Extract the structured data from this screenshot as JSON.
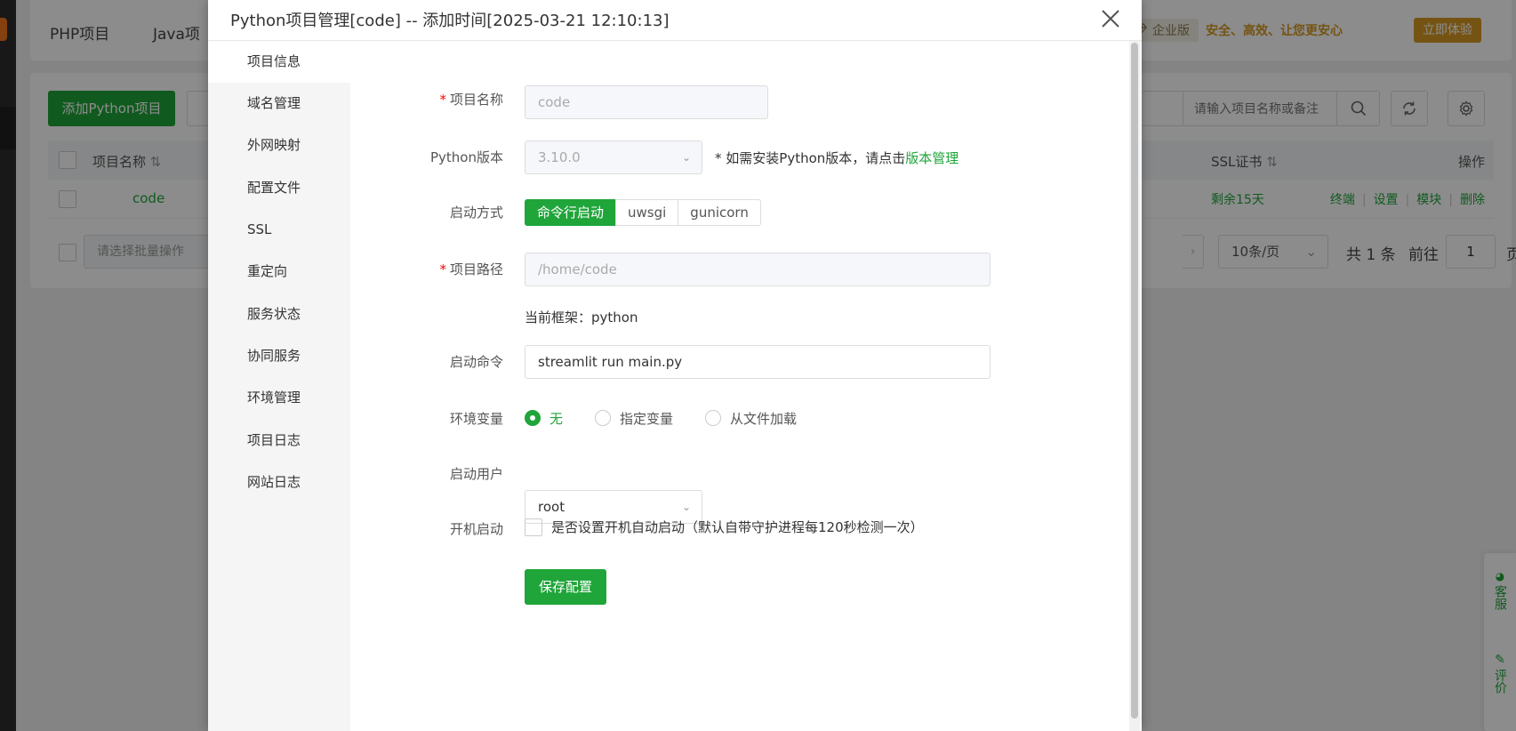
{
  "background": {
    "tabs": [
      "PHP项目",
      "Java项"
    ],
    "enterprise_badge": "企业版",
    "enterprise_slogan": "安全、高效、让您更安心",
    "trial_button": "立即体验",
    "add_button": "添加Python项目",
    "search_placeholder": "请输入项目名称或备注",
    "table": {
      "col_name": "项目名称",
      "col_ssl": "SSL证书",
      "col_ops": "操作",
      "row": {
        "name": "code",
        "ssl": "剩余15天",
        "ops": [
          "终端",
          "设置",
          "模块",
          "删除"
        ]
      }
    },
    "batch_placeholder": "请选择批量操作",
    "page_size": "10条/页",
    "total_text": "共 1 条",
    "goto_text": "前往",
    "page_value": "1",
    "page_unit": "页",
    "float_tools": {
      "service": "客服",
      "review": "评价"
    }
  },
  "modal": {
    "title": "Python项目管理[code] -- 添加时间[2025-03-21 12:10:13]",
    "nav": [
      "项目信息",
      "域名管理",
      "外网映射",
      "配置文件",
      "SSL",
      "重定向",
      "服务状态",
      "协同服务",
      "环境管理",
      "项目日志",
      "网站日志"
    ],
    "form": {
      "name_label": "项目名称",
      "name_value": "code",
      "python_label": "Python版本",
      "python_value": "3.10.0",
      "python_hint": "* 如需安装Python版本，请点击",
      "python_hint_link": "版本管理",
      "start_mode_label": "启动方式",
      "start_modes": [
        "命令行启动",
        "uwsgi",
        "gunicorn"
      ],
      "path_label": "项目路径",
      "path_value": "/home/code",
      "framework_text": "当前框架：python",
      "command_label": "启动命令",
      "command_value": "streamlit run main.py",
      "env_label": "环境变量",
      "env_options": [
        "无",
        "指定变量",
        "从文件加载"
      ],
      "user_label": "启动用户",
      "user_value": "root",
      "boot_label": "开机启动",
      "boot_text": "是否设置开机自动启动（默认自带守护进程每120秒检测一次）",
      "save_button": "保存配置"
    }
  },
  "colors": {
    "primary": "#20a53a",
    "required": "#ef0808",
    "gold": "#d69a24"
  }
}
